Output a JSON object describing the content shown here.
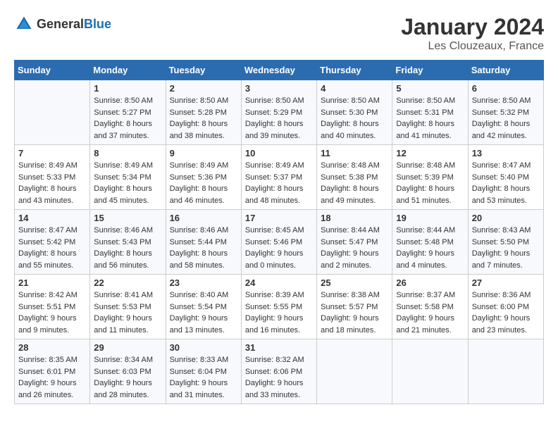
{
  "header": {
    "logo_general": "General",
    "logo_blue": "Blue",
    "title": "January 2024",
    "subtitle": "Les Clouzeaux, France"
  },
  "days_of_week": [
    "Sunday",
    "Monday",
    "Tuesday",
    "Wednesday",
    "Thursday",
    "Friday",
    "Saturday"
  ],
  "weeks": [
    [
      {
        "day": "",
        "sunrise": "",
        "sunset": "",
        "daylight": ""
      },
      {
        "day": "1",
        "sunrise": "Sunrise: 8:50 AM",
        "sunset": "Sunset: 5:27 PM",
        "daylight": "Daylight: 8 hours and 37 minutes."
      },
      {
        "day": "2",
        "sunrise": "Sunrise: 8:50 AM",
        "sunset": "Sunset: 5:28 PM",
        "daylight": "Daylight: 8 hours and 38 minutes."
      },
      {
        "day": "3",
        "sunrise": "Sunrise: 8:50 AM",
        "sunset": "Sunset: 5:29 PM",
        "daylight": "Daylight: 8 hours and 39 minutes."
      },
      {
        "day": "4",
        "sunrise": "Sunrise: 8:50 AM",
        "sunset": "Sunset: 5:30 PM",
        "daylight": "Daylight: 8 hours and 40 minutes."
      },
      {
        "day": "5",
        "sunrise": "Sunrise: 8:50 AM",
        "sunset": "Sunset: 5:31 PM",
        "daylight": "Daylight: 8 hours and 41 minutes."
      },
      {
        "day": "6",
        "sunrise": "Sunrise: 8:50 AM",
        "sunset": "Sunset: 5:32 PM",
        "daylight": "Daylight: 8 hours and 42 minutes."
      }
    ],
    [
      {
        "day": "7",
        "sunrise": "Sunrise: 8:49 AM",
        "sunset": "Sunset: 5:33 PM",
        "daylight": "Daylight: 8 hours and 43 minutes."
      },
      {
        "day": "8",
        "sunrise": "Sunrise: 8:49 AM",
        "sunset": "Sunset: 5:34 PM",
        "daylight": "Daylight: 8 hours and 45 minutes."
      },
      {
        "day": "9",
        "sunrise": "Sunrise: 8:49 AM",
        "sunset": "Sunset: 5:36 PM",
        "daylight": "Daylight: 8 hours and 46 minutes."
      },
      {
        "day": "10",
        "sunrise": "Sunrise: 8:49 AM",
        "sunset": "Sunset: 5:37 PM",
        "daylight": "Daylight: 8 hours and 48 minutes."
      },
      {
        "day": "11",
        "sunrise": "Sunrise: 8:48 AM",
        "sunset": "Sunset: 5:38 PM",
        "daylight": "Daylight: 8 hours and 49 minutes."
      },
      {
        "day": "12",
        "sunrise": "Sunrise: 8:48 AM",
        "sunset": "Sunset: 5:39 PM",
        "daylight": "Daylight: 8 hours and 51 minutes."
      },
      {
        "day": "13",
        "sunrise": "Sunrise: 8:47 AM",
        "sunset": "Sunset: 5:40 PM",
        "daylight": "Daylight: 8 hours and 53 minutes."
      }
    ],
    [
      {
        "day": "14",
        "sunrise": "Sunrise: 8:47 AM",
        "sunset": "Sunset: 5:42 PM",
        "daylight": "Daylight: 8 hours and 55 minutes."
      },
      {
        "day": "15",
        "sunrise": "Sunrise: 8:46 AM",
        "sunset": "Sunset: 5:43 PM",
        "daylight": "Daylight: 8 hours and 56 minutes."
      },
      {
        "day": "16",
        "sunrise": "Sunrise: 8:46 AM",
        "sunset": "Sunset: 5:44 PM",
        "daylight": "Daylight: 8 hours and 58 minutes."
      },
      {
        "day": "17",
        "sunrise": "Sunrise: 8:45 AM",
        "sunset": "Sunset: 5:46 PM",
        "daylight": "Daylight: 9 hours and 0 minutes."
      },
      {
        "day": "18",
        "sunrise": "Sunrise: 8:44 AM",
        "sunset": "Sunset: 5:47 PM",
        "daylight": "Daylight: 9 hours and 2 minutes."
      },
      {
        "day": "19",
        "sunrise": "Sunrise: 8:44 AM",
        "sunset": "Sunset: 5:48 PM",
        "daylight": "Daylight: 9 hours and 4 minutes."
      },
      {
        "day": "20",
        "sunrise": "Sunrise: 8:43 AM",
        "sunset": "Sunset: 5:50 PM",
        "daylight": "Daylight: 9 hours and 7 minutes."
      }
    ],
    [
      {
        "day": "21",
        "sunrise": "Sunrise: 8:42 AM",
        "sunset": "Sunset: 5:51 PM",
        "daylight": "Daylight: 9 hours and 9 minutes."
      },
      {
        "day": "22",
        "sunrise": "Sunrise: 8:41 AM",
        "sunset": "Sunset: 5:53 PM",
        "daylight": "Daylight: 9 hours and 11 minutes."
      },
      {
        "day": "23",
        "sunrise": "Sunrise: 8:40 AM",
        "sunset": "Sunset: 5:54 PM",
        "daylight": "Daylight: 9 hours and 13 minutes."
      },
      {
        "day": "24",
        "sunrise": "Sunrise: 8:39 AM",
        "sunset": "Sunset: 5:55 PM",
        "daylight": "Daylight: 9 hours and 16 minutes."
      },
      {
        "day": "25",
        "sunrise": "Sunrise: 8:38 AM",
        "sunset": "Sunset: 5:57 PM",
        "daylight": "Daylight: 9 hours and 18 minutes."
      },
      {
        "day": "26",
        "sunrise": "Sunrise: 8:37 AM",
        "sunset": "Sunset: 5:58 PM",
        "daylight": "Daylight: 9 hours and 21 minutes."
      },
      {
        "day": "27",
        "sunrise": "Sunrise: 8:36 AM",
        "sunset": "Sunset: 6:00 PM",
        "daylight": "Daylight: 9 hours and 23 minutes."
      }
    ],
    [
      {
        "day": "28",
        "sunrise": "Sunrise: 8:35 AM",
        "sunset": "Sunset: 6:01 PM",
        "daylight": "Daylight: 9 hours and 26 minutes."
      },
      {
        "day": "29",
        "sunrise": "Sunrise: 8:34 AM",
        "sunset": "Sunset: 6:03 PM",
        "daylight": "Daylight: 9 hours and 28 minutes."
      },
      {
        "day": "30",
        "sunrise": "Sunrise: 8:33 AM",
        "sunset": "Sunset: 6:04 PM",
        "daylight": "Daylight: 9 hours and 31 minutes."
      },
      {
        "day": "31",
        "sunrise": "Sunrise: 8:32 AM",
        "sunset": "Sunset: 6:06 PM",
        "daylight": "Daylight: 9 hours and 33 minutes."
      },
      {
        "day": "",
        "sunrise": "",
        "sunset": "",
        "daylight": ""
      },
      {
        "day": "",
        "sunrise": "",
        "sunset": "",
        "daylight": ""
      },
      {
        "day": "",
        "sunrise": "",
        "sunset": "",
        "daylight": ""
      }
    ]
  ]
}
